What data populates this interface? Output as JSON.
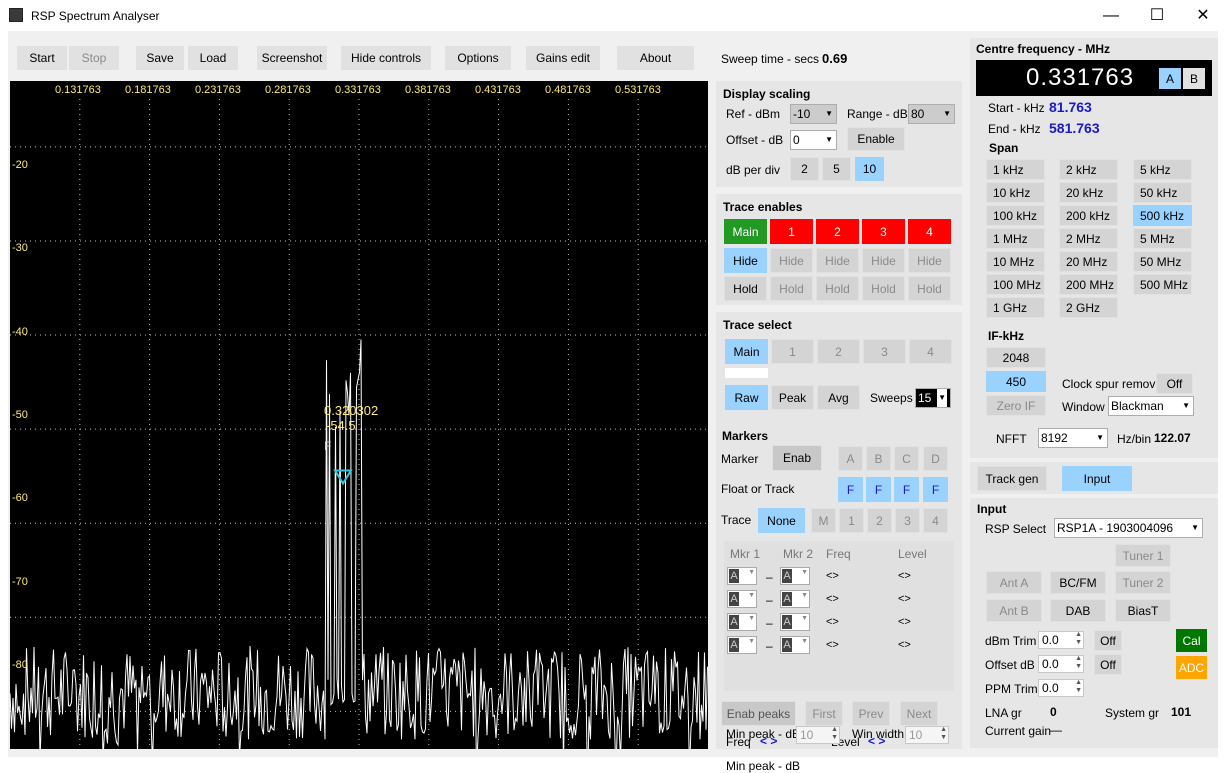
{
  "window": {
    "title": "RSP Spectrum Analyser",
    "minimize": "—",
    "maximize": "☐",
    "close": "✕"
  },
  "toolbar": {
    "start": "Start",
    "stop": "Stop",
    "save": "Save",
    "load": "Load",
    "screenshot": "Screenshot",
    "hide_controls": "Hide controls",
    "options": "Options",
    "gains_edit": "Gains edit",
    "about": "About",
    "sweep_label": "Sweep time - secs",
    "sweep_value": "0.69"
  },
  "plot": {
    "freq_ticks": [
      "0.131763",
      "0.181763",
      "0.231763",
      "0.281763",
      "0.331763",
      "0.381763",
      "0.431763",
      "0.481763",
      "0.531763"
    ],
    "level_ticks": [
      "-20",
      "-30",
      "-40",
      "-50",
      "-60",
      "-70",
      "-80"
    ],
    "marker_freq": "0.320302",
    "marker_level": "-54.5",
    "marker_tag": "F"
  },
  "chart_data": {
    "type": "line",
    "xlabel": "",
    "ylabel": "",
    "xlim": [
      0.081763,
      0.581763
    ],
    "ylim": [
      -84,
      -13
    ],
    "series": [
      {
        "values_note": ""
      }
    ],
    "peak": {
      "x": 0.320302,
      "y": -54.5
    },
    "noise_floor": -78
  },
  "display_scaling": {
    "title": "Display scaling",
    "ref_label": "Ref - dBm",
    "ref_value": "-10",
    "range_label": "Range - dB",
    "range_value": "80",
    "offset_label": "Offset - dB",
    "offset_value": "0",
    "enable": "Enable",
    "dbdiv_label": "dB per div",
    "dbdiv": [
      "2",
      "5",
      "10"
    ]
  },
  "trace_enables": {
    "title": "Trace enables",
    "cols": [
      "Main",
      "1",
      "2",
      "3",
      "4"
    ],
    "hide": "Hide",
    "hold": "Hold"
  },
  "trace_select": {
    "title": "Trace select",
    "cols": [
      "Main",
      "1",
      "2",
      "3",
      "4"
    ],
    "raw": "Raw",
    "peak": "Peak",
    "avg": "Avg",
    "sweeps_label": "Sweeps",
    "sweeps_value": "15"
  },
  "markers": {
    "title": "Markers",
    "marker_label": "Marker",
    "enab": "Enab",
    "letters": [
      "A",
      "B",
      "C",
      "D"
    ],
    "float_label": "Float or Track",
    "float": [
      "F",
      "F",
      "F",
      "F"
    ],
    "trace_label": "Trace",
    "trace_opts": [
      "None",
      "M",
      "1",
      "2",
      "3",
      "4"
    ],
    "mkr1": "Mkr 1",
    "mkr2": "Mkr 2",
    "freq_h": "Freq",
    "level_h": "Level",
    "row_val": "A",
    "dash": "–",
    "arrows": "<>",
    "enab_peaks": "Enab peaks",
    "first": "First",
    "prev": "Prev",
    "next": "Next",
    "freq_label": "Freq",
    "level_label": "Level",
    "nav": "< >",
    "minpeak_label": "Min peak - dB",
    "minpeak_value": "10",
    "winwidth_label": "Win width",
    "winwidth_value": "10"
  },
  "centre": {
    "title": "Centre frequency - MHz",
    "value": "0.331763",
    "a": "A",
    "b": "B",
    "start_label": "Start - kHz",
    "start_value": "81.763",
    "end_label": "End - kHz",
    "end_value": "581.763"
  },
  "span": {
    "title": "Span",
    "items": [
      "1 kHz",
      "2 kHz",
      "5 kHz",
      "10 kHz",
      "20 kHz",
      "50 kHz",
      "100 kHz",
      "200 kHz",
      "500 kHz",
      "1 MHz",
      "2 MHz",
      "5 MHz",
      "10 MHz",
      "20 MHz",
      "50 MHz",
      "100 MHz",
      "200 MHz",
      "500 MHz",
      "1 GHz",
      "2 GHz"
    ]
  },
  "ifkhz": {
    "title": "IF-kHz",
    "v2048": "2048",
    "v450": "450",
    "zeroif": "Zero IF",
    "clock_label": "Clock spur removal",
    "clock_value": "Off",
    "window_label": "Window",
    "window_value": "Blackman",
    "nfft_label": "NFFT",
    "nfft_value": "8192",
    "hzbin_label": "Hz/bin",
    "hzbin_value": "122.07"
  },
  "tabs": {
    "trackgen": "Track gen",
    "input": "Input"
  },
  "input": {
    "title": "Input",
    "rsp_label": "RSP Select",
    "rsp_value": "RSP1A - 1903004096",
    "tuner1": "Tuner 1",
    "tuner2": "Tuner 2",
    "anta": "Ant A",
    "antb": "Ant B",
    "bcfm": "BC/FM",
    "dab": "DAB",
    "biast": "BiasT",
    "dbmtrim_label": "dBm Trim",
    "dbmtrim_value": "0.0",
    "offset_label": "Offset dB",
    "offset_value": "0.0",
    "ppm_label": "PPM Trim",
    "ppm_value": "0.0",
    "off": "Off",
    "cal": "Cal",
    "adc": "ADC",
    "lna_label": "LNA gr",
    "lna_value": "0",
    "sys_label": "System gr",
    "sys_value": "101",
    "cur_label": "Current gain",
    "cur_value": "—"
  }
}
